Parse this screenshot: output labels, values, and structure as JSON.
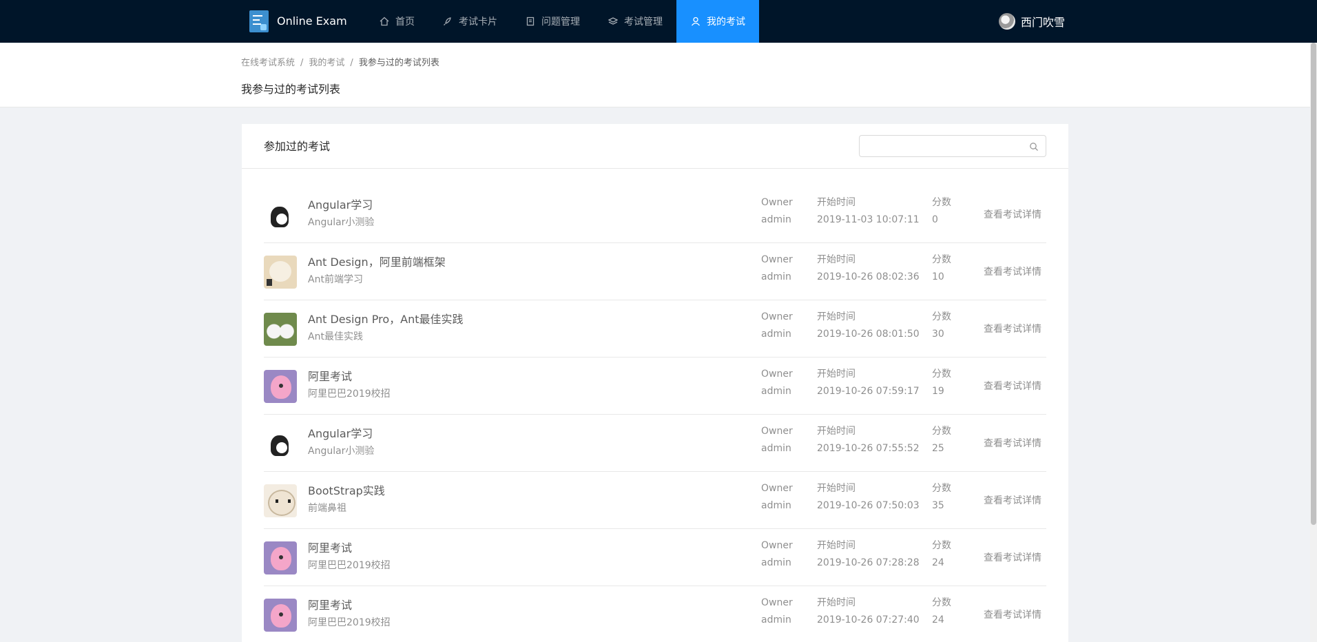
{
  "header": {
    "app_name": "Online Exam",
    "nav": [
      {
        "label": "首页",
        "icon": "home-icon",
        "active": false
      },
      {
        "label": "考试卡片",
        "icon": "rocket-icon",
        "active": false
      },
      {
        "label": "问题管理",
        "icon": "book-icon",
        "active": false
      },
      {
        "label": "考试管理",
        "icon": "layers-icon",
        "active": false
      },
      {
        "label": "我的考试",
        "icon": "user-icon",
        "active": true
      }
    ],
    "user_name": "西门吹雪",
    "colors": {
      "bg": "#001529",
      "accent": "#1890ff"
    }
  },
  "breadcrumb": [
    "在线考试系统",
    "我的考试",
    "我参与过的考试列表"
  ],
  "page_title": "我参与过的考试列表",
  "card": {
    "title": "参加过的考试",
    "search_placeholder": "",
    "owner_label": "Owner",
    "time_label": "开始时间",
    "score_label": "分数",
    "action_label": "查看考试详情"
  },
  "records": [
    {
      "title": "Angular学习",
      "subtitle": "Angular小测验",
      "owner": "admin",
      "start_time": "2019-11-03 10:07:11",
      "score": "0",
      "thumb": "cat"
    },
    {
      "title": "Ant Design，阿里前端框架",
      "subtitle": "Ant前端学习",
      "owner": "admin",
      "start_time": "2019-10-26 08:02:36",
      "score": "10",
      "thumb": "dog"
    },
    {
      "title": "Ant Design Pro，Ant最佳实践",
      "subtitle": "Ant最佳实践",
      "owner": "admin",
      "start_time": "2019-10-26 08:01:50",
      "score": "30",
      "thumb": "sam"
    },
    {
      "title": "阿里考试",
      "subtitle": "阿里巴巴2019校招",
      "owner": "admin",
      "start_time": "2019-10-26 07:59:17",
      "score": "19",
      "thumb": "fish"
    },
    {
      "title": "Angular学习",
      "subtitle": "Angular小测验",
      "owner": "admin",
      "start_time": "2019-10-26 07:55:52",
      "score": "25",
      "thumb": "cat"
    },
    {
      "title": "BootStrap实践",
      "subtitle": "前端鼻祖",
      "owner": "admin",
      "start_time": "2019-10-26 07:50:03",
      "score": "35",
      "thumb": "kit"
    },
    {
      "title": "阿里考试",
      "subtitle": "阿里巴巴2019校招",
      "owner": "admin",
      "start_time": "2019-10-26 07:28:28",
      "score": "24",
      "thumb": "fish"
    },
    {
      "title": "阿里考试",
      "subtitle": "阿里巴巴2019校招",
      "owner": "admin",
      "start_time": "2019-10-26 07:27:40",
      "score": "24",
      "thumb": "fish"
    }
  ]
}
